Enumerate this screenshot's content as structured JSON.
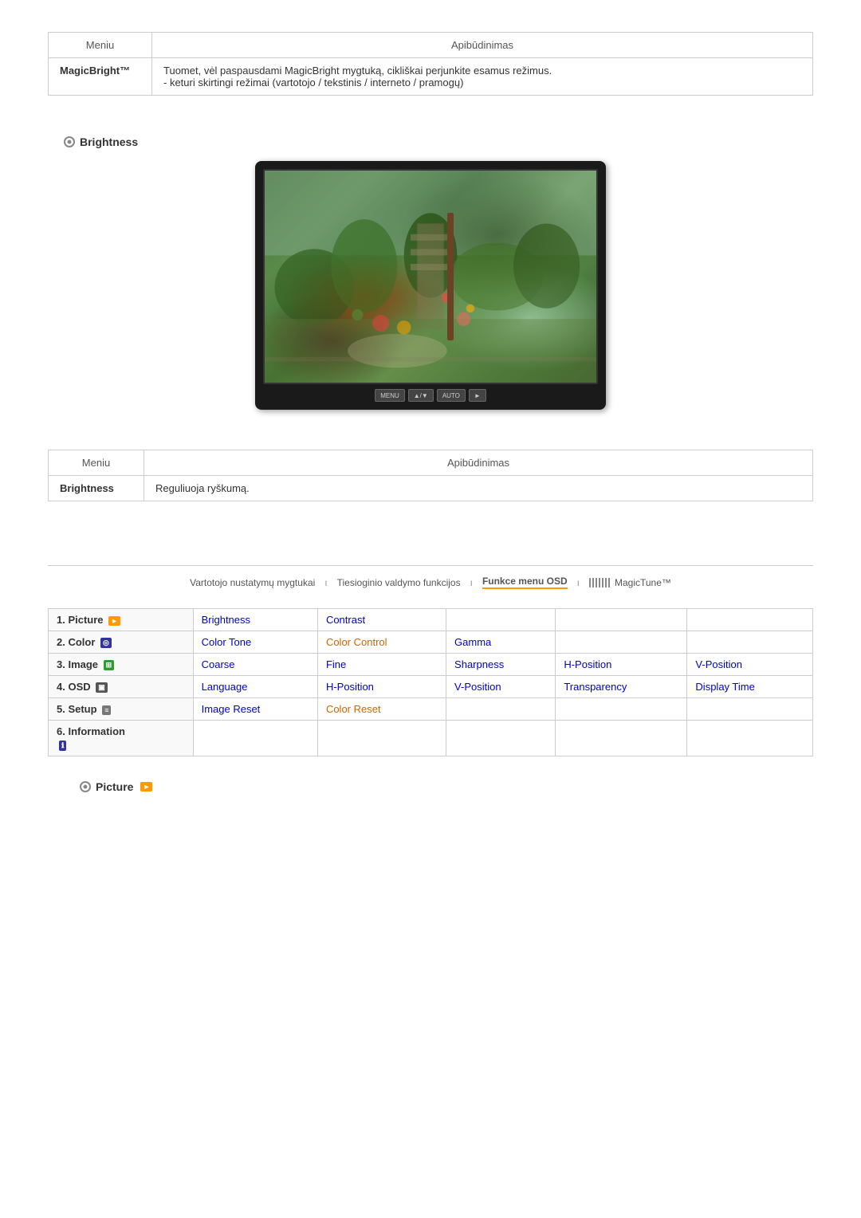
{
  "top_table": {
    "col1_header": "Meniu",
    "col2_header": "Apibūdinimas",
    "row1_col1": "MagicBright™",
    "row1_col2": "Tuomet, vėl paspausdami MagicBright mygtuką, cikliškai perjunkite esamus režimus.\n- keturi skirtingi režimai (vartotojo / tekstinis / interneto / pramogų)"
  },
  "brightness_section": {
    "title": "Brightness",
    "monitor_buttons": [
      "MENU",
      "▲/▼",
      "AUTO",
      "►"
    ]
  },
  "mid_table": {
    "col1_header": "Meniu",
    "col2_header": "Apibūdinimas",
    "row1_col1": "Brightness",
    "row1_col2": "Reguliuoja ryškumą."
  },
  "nav_bar": {
    "item1": "Vartotojo nustatymų mygtukai",
    "item2": "Tiesioginio valdymo funkcijos",
    "item3": "Funkce menu OSD",
    "item4": "MagicTune™",
    "separator": "ı"
  },
  "menu_grid": {
    "rows": [
      {
        "label": "1. Picture",
        "badge_type": "orange",
        "cells": [
          "Brightness",
          "Contrast",
          "",
          "",
          ""
        ]
      },
      {
        "label": "2. Color",
        "badge_type": "blue",
        "cells": [
          "Color Tone",
          "Color Control",
          "Gamma",
          "",
          ""
        ]
      },
      {
        "label": "3. Image",
        "badge_type": "green",
        "cells": [
          "Coarse",
          "Fine",
          "Sharpness",
          "H-Position",
          "V-Position"
        ]
      },
      {
        "label": "4. OSD",
        "badge_type": "dark",
        "cells": [
          "Language",
          "H-Position",
          "V-Position",
          "Transparency",
          "Display Time"
        ]
      },
      {
        "label": "5. Setup",
        "badge_type": "gray",
        "cells": [
          "Image Reset",
          "Color Reset",
          "",
          "",
          ""
        ]
      },
      {
        "label": "6. Information",
        "badge_type": "info",
        "cells": [
          "",
          "",
          "",
          "",
          ""
        ]
      }
    ]
  },
  "bottom_section": {
    "title": "Picture",
    "badge_label": "►"
  }
}
